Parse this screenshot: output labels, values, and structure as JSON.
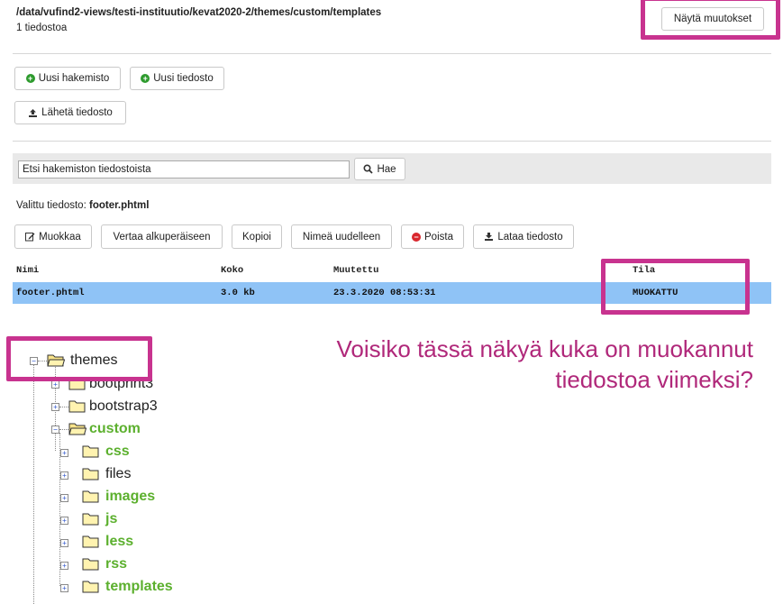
{
  "header": {
    "path": "/data/vufind2-views/testi-instituutio/kevat2020-2/themes/custom/templates",
    "file_count": "1 tiedostoa",
    "show_changes_label": "Näytä muutokset"
  },
  "actions": {
    "new_directory": "Uusi hakemisto",
    "new_file": "Uusi tiedosto",
    "upload_file": "Lähetä tiedosto"
  },
  "search": {
    "placeholder": "Etsi hakemiston tiedostoista",
    "button_label": "Hae"
  },
  "selected": {
    "prefix": "Valittu tiedosto:",
    "filename": "footer.phtml"
  },
  "file_actions": {
    "edit": "Muokkaa",
    "compare": "Vertaa alkuperäiseen",
    "copy": "Kopioi",
    "rename": "Nimeä uudelleen",
    "delete": "Poista",
    "download": "Lataa tiedosto"
  },
  "table": {
    "columns": [
      "Nimi",
      "Koko",
      "Muutettu",
      "Tila"
    ],
    "rows": [
      [
        "footer.phtml",
        "3.0 kb",
        "23.3.2020 08:53:31",
        "MUOKATTU"
      ]
    ]
  },
  "annotation": {
    "line1": "Voisiko tässä näkyä kuka on muokannut",
    "line2": "tiedostoa viimeksi?"
  },
  "tree": {
    "root": "themes",
    "children": [
      "bootprint3",
      "bootstrap3",
      "custom"
    ],
    "custom_children": [
      "css",
      "files",
      "images",
      "js",
      "less",
      "rss",
      "templates"
    ],
    "highlight_color": "#c8338f",
    "modified_color": "#5cb02e"
  }
}
